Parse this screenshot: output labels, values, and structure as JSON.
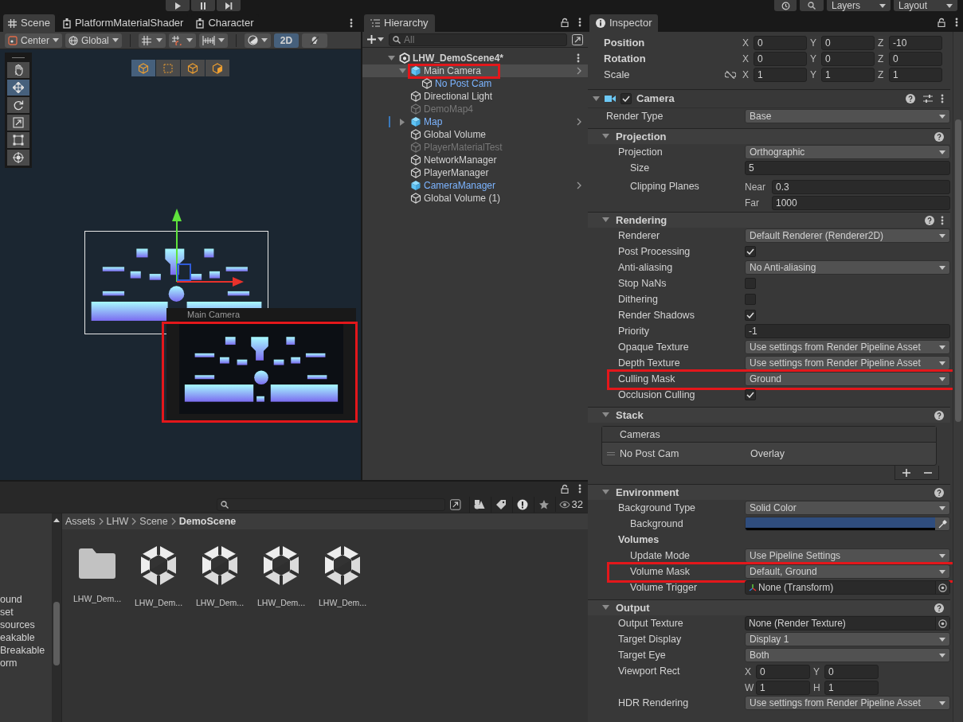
{
  "toolbar": {
    "layers": "Layers",
    "layout": "Layout"
  },
  "scene_panel": {
    "tabs": [
      {
        "label": "Scene",
        "kind": "scene",
        "selected": true
      },
      {
        "label": "PlatformMaterialShader",
        "kind": "shader",
        "selected": false
      },
      {
        "label": "Character",
        "kind": "shader",
        "selected": false
      }
    ],
    "pivot": "Center",
    "space": "Global",
    "mode_2d": {
      "label": "2D",
      "on": true
    },
    "lighting": {
      "on": false
    },
    "tools": [
      {
        "kind": "hand",
        "selected": false
      },
      {
        "kind": "move",
        "selected": true
      },
      {
        "kind": "rotate",
        "selected": false
      },
      {
        "kind": "scale",
        "selected": false
      },
      {
        "kind": "rect",
        "selected": false
      },
      {
        "kind": "transform",
        "selected": false
      }
    ],
    "view_buttons": [
      {
        "kind": "cube",
        "selected": true
      },
      {
        "kind": "rect",
        "selected": false
      },
      {
        "kind": "cube",
        "selected": false
      },
      {
        "kind": "cube_half",
        "selected": false
      }
    ],
    "camera_preview": {
      "title": "Main Camera",
      "highlighted": true
    }
  },
  "hierarchy": {
    "title": "Hierarchy",
    "search_placeholder": "All",
    "scene": {
      "name": "LHW_DemoScene4*",
      "expanded": true,
      "children": [
        {
          "name": "Main Camera",
          "kind": "prefab",
          "linked": false,
          "active": true,
          "selected": true,
          "highlighted": true,
          "arrow": true,
          "expanded": true,
          "children": [
            {
              "name": "No Post Cam",
              "kind": "object",
              "linked": true,
              "active": true,
              "selected": false
            }
          ]
        },
        {
          "name": "Directional Light",
          "kind": "object",
          "linked": false,
          "active": true,
          "selected": false
        },
        {
          "name": "DemoMap4",
          "kind": "object",
          "linked": false,
          "active": false,
          "selected": false
        },
        {
          "name": "Map",
          "kind": "prefab",
          "linked": true,
          "active": true,
          "selected": false,
          "arrow": true,
          "marked": true,
          "expanded": false
        },
        {
          "name": "Global Volume",
          "kind": "object",
          "linked": false,
          "active": true,
          "selected": false
        },
        {
          "name": "PlayerMaterialTest",
          "kind": "object",
          "linked": false,
          "active": false,
          "selected": false
        },
        {
          "name": "NetworkManager",
          "kind": "object",
          "linked": false,
          "active": true,
          "selected": false
        },
        {
          "name": "PlayerManager",
          "kind": "object",
          "linked": false,
          "active": true,
          "selected": false
        },
        {
          "name": "CameraManager",
          "kind": "prefab",
          "linked": true,
          "active": true,
          "selected": false,
          "arrow": true
        },
        {
          "name": "Global Volume (1)",
          "kind": "object",
          "linked": false,
          "active": true,
          "selected": false
        }
      ]
    }
  },
  "inspector": {
    "title": "Inspector",
    "transform": [
      {
        "label": "Position",
        "bold": true,
        "axes": [
          {
            "label": "X",
            "value": "0"
          },
          {
            "label": "Y",
            "value": "0"
          },
          {
            "label": "Z",
            "value": "-10"
          }
        ]
      },
      {
        "label": "Rotation",
        "bold": true,
        "axes": [
          {
            "label": "X",
            "value": "0"
          },
          {
            "label": "Y",
            "value": "0"
          },
          {
            "label": "Z",
            "value": "0"
          }
        ]
      },
      {
        "label": "Scale",
        "bold": false,
        "constrained": false,
        "axes": [
          {
            "label": "X",
            "value": "1"
          },
          {
            "label": "Y",
            "value": "1"
          },
          {
            "label": "Z",
            "value": "1"
          }
        ]
      }
    ],
    "component": {
      "name": "Camera",
      "enabled": true,
      "fields": [
        {
          "label": "Render Type",
          "kind": "dropdown",
          "value": "Base"
        }
      ],
      "sections": [
        {
          "title": "Projection",
          "fields": [
            {
              "label": "Projection",
              "kind": "dropdown",
              "value": "Orthographic",
              "children": [
                {
                  "label": "Size",
                  "kind": "number",
                  "value": "5"
                },
                {
                  "label": "Clipping Planes",
                  "kind": "near_far",
                  "near_label": "Near",
                  "near": "0.3",
                  "far_label": "Far",
                  "far": "1000"
                }
              ]
            }
          ]
        },
        {
          "title": "Rendering",
          "menu": true,
          "fields": [
            {
              "label": "Renderer",
              "kind": "dropdown",
              "value": "Default Renderer (Renderer2D)"
            },
            {
              "label": "Post Processing",
              "kind": "checkbox",
              "checked": true
            },
            {
              "label": "Anti-aliasing",
              "kind": "dropdown",
              "value": "No Anti-aliasing"
            },
            {
              "label": "Stop NaNs",
              "kind": "checkbox",
              "checked": false
            },
            {
              "label": "Dithering",
              "kind": "checkbox",
              "checked": false
            },
            {
              "label": "Render Shadows",
              "kind": "checkbox",
              "checked": true
            },
            {
              "label": "Priority",
              "kind": "number",
              "value": "-1"
            },
            {
              "label": "Opaque Texture",
              "kind": "dropdown",
              "value": "Use settings from Render Pipeline Asset"
            },
            {
              "label": "Depth Texture",
              "kind": "dropdown",
              "value": "Use settings from Render Pipeline Asset"
            },
            {
              "label": "Culling Mask",
              "kind": "dropdown",
              "value": "Ground",
              "highlighted": true
            },
            {
              "label": "Occlusion Culling",
              "kind": "checkbox",
              "checked": true
            }
          ]
        },
        {
          "title": "Stack",
          "list": {
            "header": "Cameras",
            "items": [
              {
                "name": "No Post Cam",
                "type": "Overlay"
              }
            ]
          }
        },
        {
          "title": "Environment",
          "fields": [
            {
              "label": "Background Type",
              "kind": "dropdown",
              "value": "Solid Color",
              "children": [
                {
                  "label": "Background",
                  "kind": "color",
                  "color": "#2f4d7e"
                }
              ]
            },
            {
              "label": "Volumes",
              "kind": "heading",
              "children": [
                {
                  "label": "Update Mode",
                  "kind": "dropdown",
                  "value": "Use Pipeline Settings"
                },
                {
                  "label": "Volume Mask",
                  "kind": "dropdown",
                  "value": "Default, Ground",
                  "highlighted": true
                },
                {
                  "label": "Volume Trigger",
                  "kind": "object",
                  "value": "None (Transform)",
                  "transform_icon": true
                }
              ]
            }
          ]
        },
        {
          "title": "Output",
          "fields": [
            {
              "label": "Output Texture",
              "kind": "object",
              "value": "None (Render Texture)"
            },
            {
              "label": "Target Display",
              "kind": "dropdown",
              "value": "Display 1"
            },
            {
              "label": "Target Eye",
              "kind": "dropdown",
              "value": "Both"
            },
            {
              "label": "Viewport Rect",
              "kind": "rect",
              "rows": [
                {
                  "axes": [
                    {
                      "label": "X",
                      "value": "0"
                    },
                    {
                      "label": "Y",
                      "value": "0"
                    }
                  ]
                },
                {
                  "axes": [
                    {
                      "label": "W",
                      "value": "1"
                    },
                    {
                      "label": "H",
                      "value": "1"
                    }
                  ]
                }
              ]
            },
            {
              "label": "HDR Rendering",
              "kind": "dropdown",
              "value": "Use settings from Render Pipeline Asset"
            }
          ]
        }
      ]
    }
  },
  "project": {
    "sidebar_items": [
      "ound",
      "set",
      "sources",
      "eakable",
      "Breakable",
      "orm"
    ],
    "hidden_count": "32",
    "breadcrumb": [
      {
        "label": "Assets",
        "current": false
      },
      {
        "label": "LHW",
        "current": false
      },
      {
        "label": "Scene",
        "current": false
      },
      {
        "label": "DemoScene",
        "current": true
      }
    ],
    "assets": [
      {
        "name": "LHW_Dem...",
        "kind": "folder"
      },
      {
        "name": "LHW_Dem...",
        "kind": "scene"
      },
      {
        "name": "LHW_Dem...",
        "kind": "scene"
      },
      {
        "name": "LHW_Dem...",
        "kind": "scene"
      },
      {
        "name": "LHW_Dem...",
        "kind": "scene"
      }
    ]
  }
}
